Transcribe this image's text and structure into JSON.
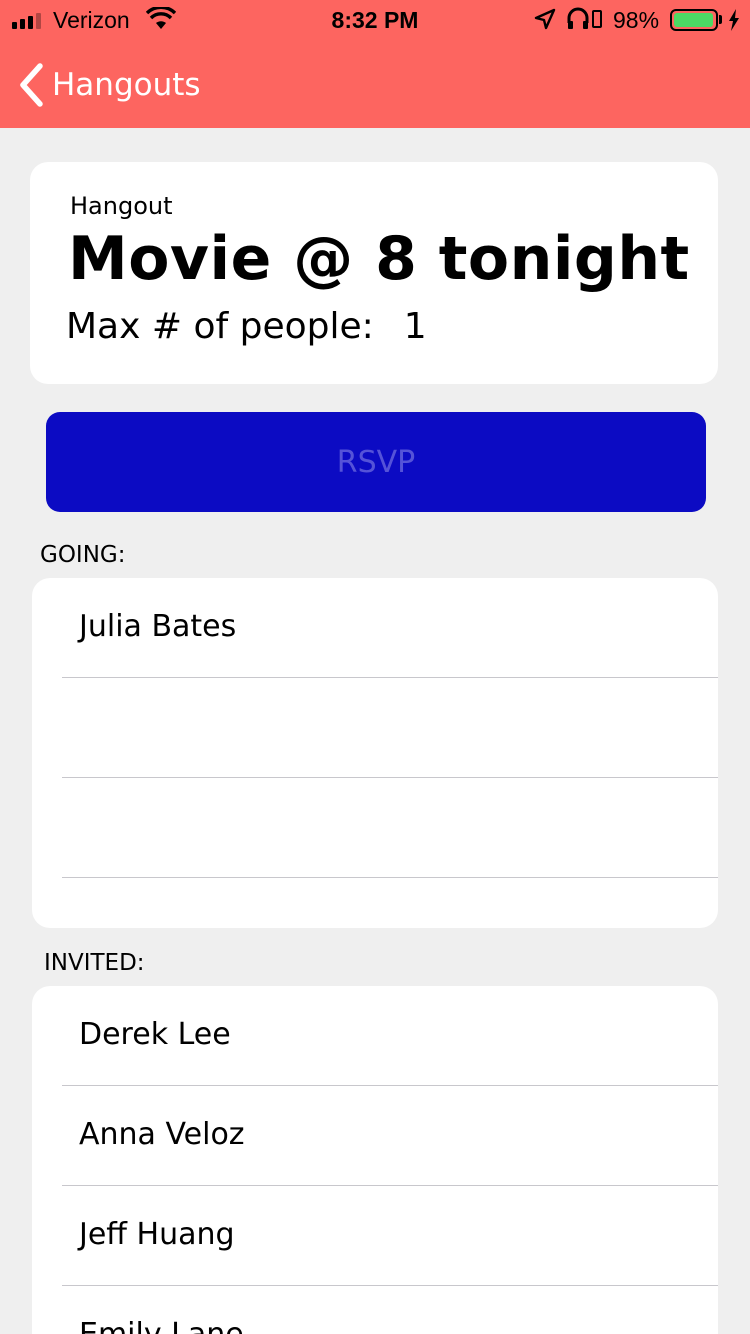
{
  "status_bar": {
    "carrier": "Verizon",
    "time": "8:32 PM",
    "battery_percent": "98%",
    "battery_level": 0.98,
    "signal_bars_filled": 3,
    "signal_bars_total": 4
  },
  "nav": {
    "back_label": "Hangouts",
    "color": "#fd6560"
  },
  "hangout": {
    "kicker": "Hangout",
    "title": "Movie @ 8 tonight",
    "max_label": "Max # of people:",
    "max_value": "1"
  },
  "rsvp": {
    "label": "RSVP",
    "background": "#0c0bc3"
  },
  "going": {
    "label": "GOING:",
    "people": [
      "Julia Bates",
      "",
      ""
    ]
  },
  "invited": {
    "label": "INVITED:",
    "people": [
      "Derek Lee",
      "Anna Veloz",
      "Jeff Huang",
      "Emily Lane"
    ]
  }
}
